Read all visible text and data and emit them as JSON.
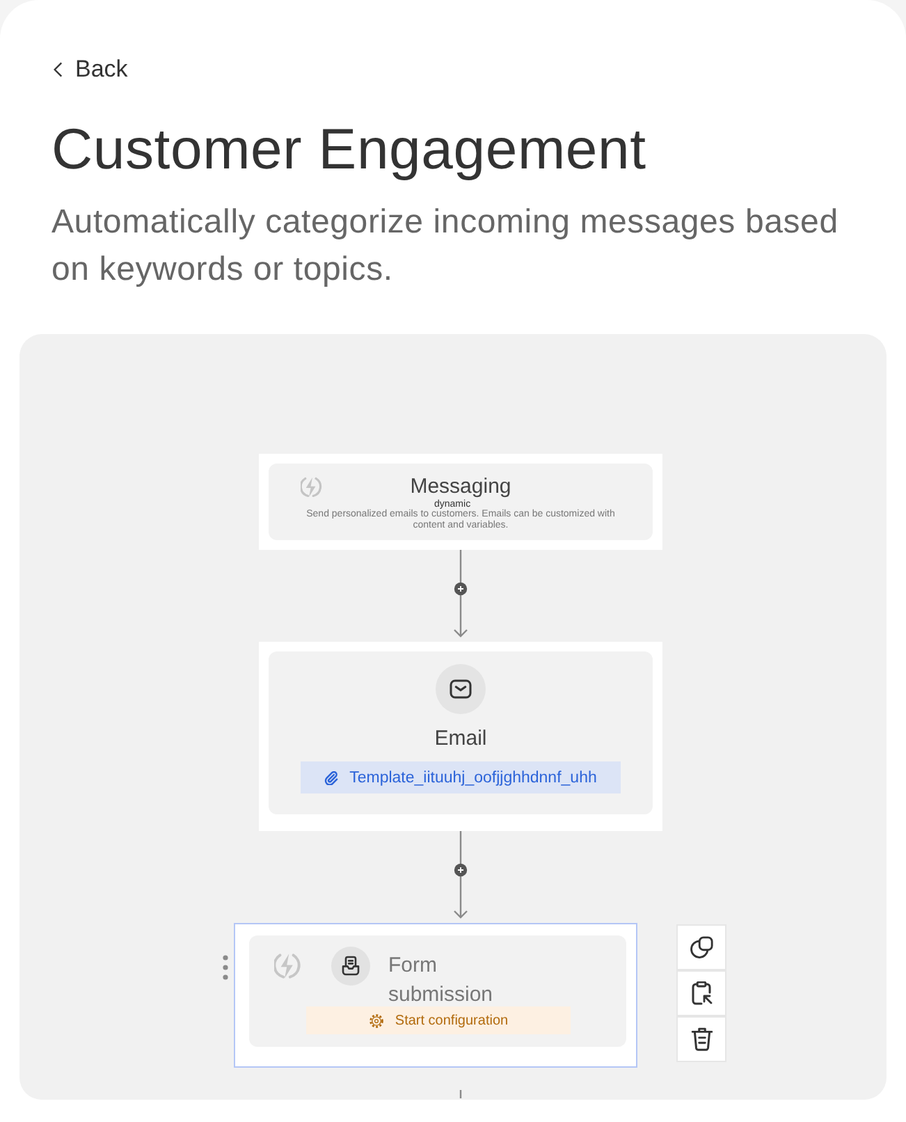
{
  "back": {
    "label": "Back"
  },
  "header": {
    "title": "Customer Engagement",
    "subtitle": "Automatically categorize incoming messages based on keywords or topics."
  },
  "flow": {
    "nodes": [
      {
        "kind": "trigger",
        "title": "Messaging",
        "description": "Send personalized emails to customers. Emails can be customized with content and variables.",
        "overlay_label": "dynamic",
        "selected": false
      },
      {
        "kind": "email",
        "title": "Email",
        "template": "Template_iituuhj_oofjjghhdnnf_uhh",
        "selected": false
      },
      {
        "kind": "form",
        "title": "Form submission",
        "status": "Start configuration",
        "selected": true
      }
    ]
  }
}
